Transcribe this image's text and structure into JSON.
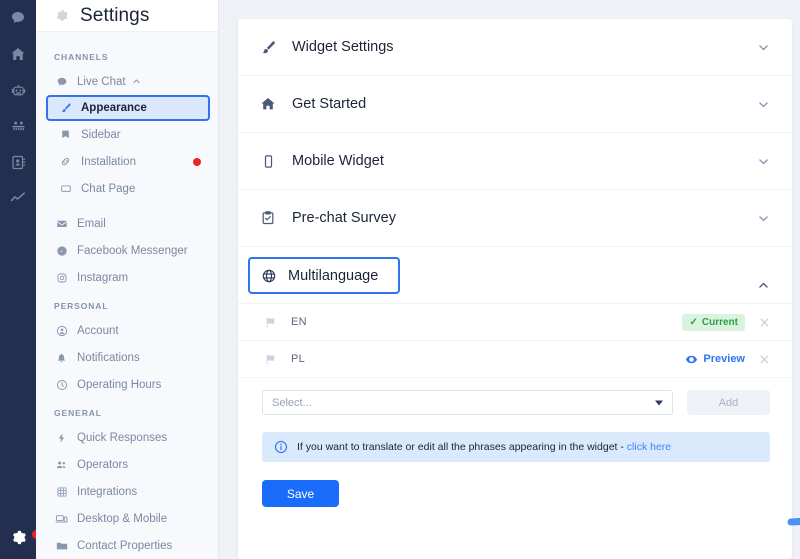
{
  "rail": {
    "items": [
      {
        "name": "chat-icon",
        "label": "Chat"
      },
      {
        "name": "home-icon",
        "label": "Home"
      },
      {
        "name": "bot-icon",
        "label": "Chatbot"
      },
      {
        "name": "team-icon",
        "label": "Team"
      },
      {
        "name": "contacts-icon",
        "label": "Contacts"
      },
      {
        "name": "analytics-icon",
        "label": "Analytics"
      }
    ],
    "bottom": {
      "name": "settings-gear-icon",
      "label": "Settings",
      "has_notification_dot": true
    }
  },
  "sidebar": {
    "title": "Settings",
    "groups": [
      {
        "label": "CHANNELS",
        "items": [
          {
            "label": "Live Chat",
            "icon": "chat-bubble-icon",
            "expanded": true,
            "caret": "⌃"
          },
          {
            "label": "Appearance",
            "icon": "brush-icon",
            "active": true,
            "sub": true
          },
          {
            "label": "Sidebar",
            "icon": "bookmark-icon",
            "sub": true
          },
          {
            "label": "Installation",
            "icon": "link-icon",
            "sub": true,
            "dot": true
          },
          {
            "label": "Chat Page",
            "icon": "window-icon",
            "sub": true
          },
          {
            "label": "Email",
            "icon": "envelope-icon"
          },
          {
            "label": "Facebook Messenger",
            "icon": "messenger-icon"
          },
          {
            "label": "Instagram",
            "icon": "instagram-icon"
          }
        ]
      },
      {
        "label": "PERSONAL",
        "items": [
          {
            "label": "Account",
            "icon": "user-circle-icon"
          },
          {
            "label": "Notifications",
            "icon": "bell-icon"
          },
          {
            "label": "Operating Hours",
            "icon": "clock-icon"
          }
        ]
      },
      {
        "label": "GENERAL",
        "items": [
          {
            "label": "Quick Responses",
            "icon": "bolt-icon"
          },
          {
            "label": "Operators",
            "icon": "users-icon"
          },
          {
            "label": "Integrations",
            "icon": "grid-icon"
          },
          {
            "label": "Desktop & Mobile",
            "icon": "devices-icon"
          },
          {
            "label": "Contact Properties",
            "icon": "folder-icon"
          }
        ]
      }
    ]
  },
  "main": {
    "sections": [
      {
        "label": "Widget Settings",
        "icon": "brush-icon",
        "expanded": false,
        "chevron": "down"
      },
      {
        "label": "Get Started",
        "icon": "home-icon",
        "expanded": false,
        "chevron": "down"
      },
      {
        "label": "Mobile Widget",
        "icon": "mobile-icon",
        "expanded": false,
        "chevron": "down"
      },
      {
        "label": "Pre-chat Survey",
        "icon": "clipboard-check-icon",
        "expanded": false,
        "chevron": "down"
      },
      {
        "label": "Multilanguage",
        "icon": "globe-icon",
        "expanded": true,
        "chevron": "up",
        "selected": true
      }
    ],
    "multilanguage": {
      "languages": [
        {
          "code": "EN",
          "flag_icon": "flag-icon",
          "status_label": "Current",
          "status_type": "current",
          "check": "✓",
          "remove_label": "×"
        },
        {
          "code": "PL",
          "flag_icon": "flag-icon",
          "status_label": "Preview",
          "status_type": "preview",
          "remove_label": "×"
        }
      ],
      "select": {
        "placeholder": "Select...",
        "value": ""
      },
      "add_button": "Add",
      "info": {
        "icon": "info-circle-icon",
        "text": "If you want to translate or edit all the phrases appearing in the widget - ",
        "link_label": "click here"
      },
      "save_button": "Save"
    }
  },
  "colors": {
    "accent_blue": "#2f73f0",
    "save_blue": "#1a6dfb",
    "rail_navy": "#222f4e",
    "current_green": "#2f9e4a",
    "current_green_bg": "#d9f3de",
    "notification_red": "#e8232a",
    "info_bg": "#dbe9fd",
    "page_bg": "#eef1f6"
  }
}
